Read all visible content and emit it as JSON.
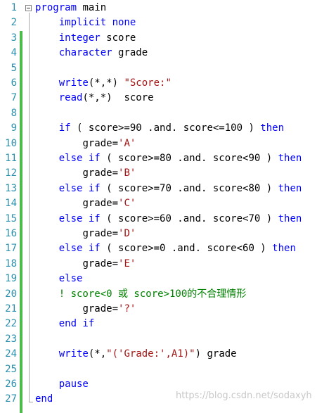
{
  "editor": {
    "lines": [
      {
        "num": "1",
        "indent": "",
        "segs": [
          {
            "t": "kw",
            "v": "program"
          },
          {
            "t": "plain",
            "v": " main"
          }
        ]
      },
      {
        "num": "2",
        "indent": "    ",
        "segs": [
          {
            "t": "kw",
            "v": "implicit none"
          }
        ]
      },
      {
        "num": "3",
        "indent": "    ",
        "segs": [
          {
            "t": "kw",
            "v": "integer"
          },
          {
            "t": "plain",
            "v": " score"
          }
        ]
      },
      {
        "num": "4",
        "indent": "    ",
        "segs": [
          {
            "t": "kw",
            "v": "character"
          },
          {
            "t": "plain",
            "v": " grade"
          }
        ]
      },
      {
        "num": "5",
        "indent": "",
        "segs": []
      },
      {
        "num": "6",
        "indent": "    ",
        "segs": [
          {
            "t": "kw",
            "v": "write"
          },
          {
            "t": "plain",
            "v": "(*,*) "
          },
          {
            "t": "str",
            "v": "\"Score:\""
          }
        ]
      },
      {
        "num": "7",
        "indent": "    ",
        "segs": [
          {
            "t": "kw",
            "v": "read"
          },
          {
            "t": "plain",
            "v": "(*,*)  score"
          }
        ]
      },
      {
        "num": "8",
        "indent": "",
        "segs": []
      },
      {
        "num": "9",
        "indent": "    ",
        "segs": [
          {
            "t": "kw",
            "v": "if"
          },
          {
            "t": "plain",
            "v": " ( score>=90 .and. score<=100 ) "
          },
          {
            "t": "kw",
            "v": "then"
          }
        ]
      },
      {
        "num": "10",
        "indent": "        ",
        "segs": [
          {
            "t": "plain",
            "v": "grade="
          },
          {
            "t": "str",
            "v": "'A'"
          }
        ]
      },
      {
        "num": "11",
        "indent": "    ",
        "segs": [
          {
            "t": "kw",
            "v": "else if"
          },
          {
            "t": "plain",
            "v": " ( score>=80 .and. score<90 ) "
          },
          {
            "t": "kw",
            "v": "then"
          }
        ]
      },
      {
        "num": "12",
        "indent": "        ",
        "segs": [
          {
            "t": "plain",
            "v": "grade="
          },
          {
            "t": "str",
            "v": "'B'"
          }
        ]
      },
      {
        "num": "13",
        "indent": "    ",
        "segs": [
          {
            "t": "kw",
            "v": "else if"
          },
          {
            "t": "plain",
            "v": " ( score>=70 .and. score<80 ) "
          },
          {
            "t": "kw",
            "v": "then"
          }
        ]
      },
      {
        "num": "14",
        "indent": "        ",
        "segs": [
          {
            "t": "plain",
            "v": "grade="
          },
          {
            "t": "str",
            "v": "'C'"
          }
        ]
      },
      {
        "num": "15",
        "indent": "    ",
        "segs": [
          {
            "t": "kw",
            "v": "else if"
          },
          {
            "t": "plain",
            "v": " ( score>=60 .and. score<70 ) "
          },
          {
            "t": "kw",
            "v": "then"
          }
        ]
      },
      {
        "num": "16",
        "indent": "        ",
        "segs": [
          {
            "t": "plain",
            "v": "grade="
          },
          {
            "t": "str",
            "v": "'D'"
          }
        ]
      },
      {
        "num": "17",
        "indent": "    ",
        "segs": [
          {
            "t": "kw",
            "v": "else if"
          },
          {
            "t": "plain",
            "v": " ( score>=0 .and. score<60 ) "
          },
          {
            "t": "kw",
            "v": "then"
          }
        ]
      },
      {
        "num": "18",
        "indent": "        ",
        "segs": [
          {
            "t": "plain",
            "v": "grade="
          },
          {
            "t": "str",
            "v": "'E'"
          }
        ]
      },
      {
        "num": "19",
        "indent": "    ",
        "segs": [
          {
            "t": "kw",
            "v": "else"
          }
        ]
      },
      {
        "num": "20",
        "indent": "    ",
        "segs": [
          {
            "t": "cm",
            "v": "! score<0 或 score>100的不合理情形"
          }
        ]
      },
      {
        "num": "21",
        "indent": "        ",
        "segs": [
          {
            "t": "plain",
            "v": "grade="
          },
          {
            "t": "str",
            "v": "'?'"
          }
        ]
      },
      {
        "num": "22",
        "indent": "    ",
        "segs": [
          {
            "t": "kw",
            "v": "end if"
          }
        ]
      },
      {
        "num": "23",
        "indent": "",
        "segs": []
      },
      {
        "num": "24",
        "indent": "    ",
        "segs": [
          {
            "t": "kw",
            "v": "write"
          },
          {
            "t": "plain",
            "v": "(*,"
          },
          {
            "t": "str",
            "v": "\"('Grade:',A1)\""
          },
          {
            "t": "plain",
            "v": ") grade"
          }
        ]
      },
      {
        "num": "25",
        "indent": "",
        "segs": []
      },
      {
        "num": "26",
        "indent": "    ",
        "segs": [
          {
            "t": "kw",
            "v": "pause"
          }
        ]
      },
      {
        "num": "27",
        "indent": "",
        "segs": [
          {
            "t": "kw",
            "v": "end"
          }
        ]
      }
    ]
  },
  "watermark": "https://blog.csdn.net/sodaxyh",
  "colors": {
    "keyword": "#0000ff",
    "string": "#a31515",
    "comment": "#008000",
    "line_number": "#2b91af",
    "change_bar": "#4cbb4c"
  },
  "icons": {
    "fold": "fold-collapse-icon"
  }
}
